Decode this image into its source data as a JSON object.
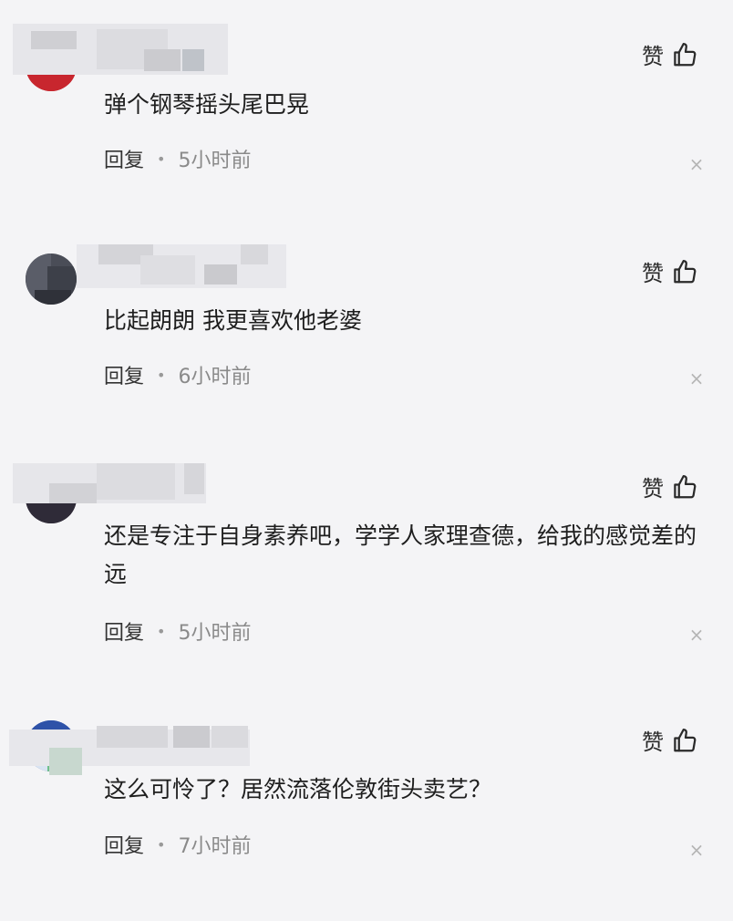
{
  "comments": [
    {
      "like_label": "赞",
      "like_icon": "thumb-up-icon",
      "text": "弹个钢琴摇头尾巴晃",
      "reply_label": "回复",
      "time": "5小时前"
    },
    {
      "like_label": "赞",
      "like_icon": "thumb-up-icon",
      "text": "比起朗朗 我更喜欢他老婆",
      "reply_label": "回复",
      "time": "6小时前"
    },
    {
      "like_label": "赞",
      "like_icon": "thumb-up-icon",
      "text": "还是专注于自身素养吧，学学人家理查德，给我的感觉差的远",
      "reply_label": "回复",
      "time": "5小时前"
    },
    {
      "like_label": "赞",
      "like_icon": "thumb-up-icon",
      "text": "这么可怜了？居然流落伦敦街头卖艺？",
      "reply_label": "回复",
      "time": "7小时前"
    }
  ],
  "colors": {
    "background": "#f4f4f6",
    "text": "#1e1e1e",
    "muted": "#8a8a8a"
  }
}
